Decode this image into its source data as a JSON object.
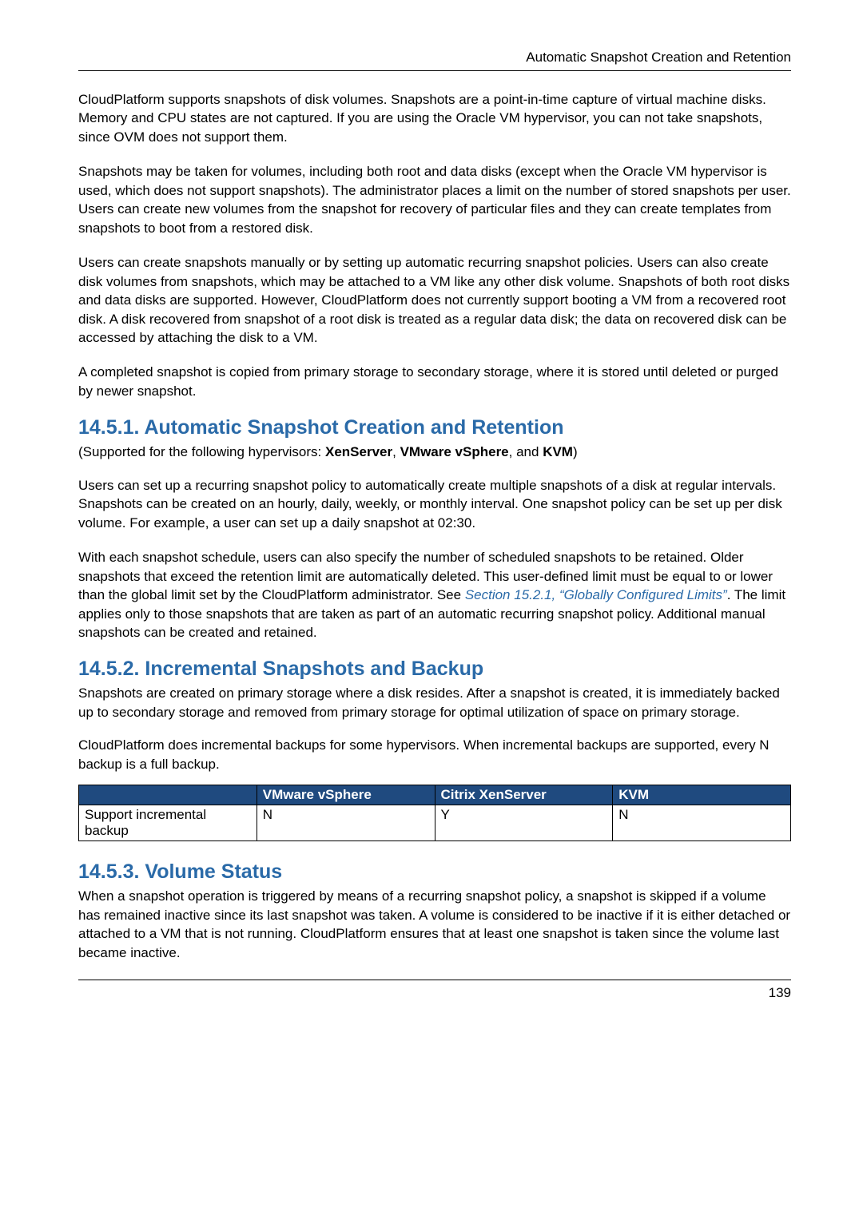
{
  "header": {
    "running": "Automatic Snapshot Creation and Retention"
  },
  "intro": {
    "p1": "CloudPlatform supports snapshots of disk volumes. Snapshots are a point-in-time capture of virtual machine disks. Memory and CPU states are not captured. If you are using the Oracle VM hypervisor, you can not take snapshots, since OVM does not support them.",
    "p2": "Snapshots may be taken for volumes, including both root and data disks (except when the Oracle VM hypervisor is used, which does not support snapshots). The administrator places a limit on the number of stored snapshots per user. Users can create new volumes from the snapshot for recovery of particular files and they can create templates from snapshots to boot from a restored disk.",
    "p3": "Users can create snapshots manually or by setting up automatic recurring snapshot policies. Users can also create disk volumes from snapshots, which may be attached to a VM like any other disk volume. Snapshots of both root disks and data disks are supported. However, CloudPlatform does not currently support booting a VM from a recovered root disk. A disk recovered from snapshot of a root disk is treated as a regular data disk; the data on recovered disk can be accessed by attaching the disk to a VM.",
    "p4": "A completed snapshot is copied from primary storage to secondary storage, where it is stored until deleted or purged by newer snapshot."
  },
  "sec1": {
    "heading": "14.5.1. Automatic Snapshot Creation and Retention",
    "sub_pre": "(Supported for the following hypervisors: ",
    "hv1": "XenServer",
    "hv2": "VMware vSphere",
    "hv3": "KVM",
    "sub_mid1": ", ",
    "sub_mid2": ", and ",
    "sub_post": ")",
    "p1": "Users can set up a recurring snapshot policy to automatically create multiple snapshots of a disk at regular intervals. Snapshots can be created on an hourly, daily, weekly, or monthly interval. One snapshot policy can be set up per disk volume. For example, a user can set up a daily snapshot at 02:30.",
    "p2a": "With each snapshot schedule, users can also specify the number of scheduled snapshots to be retained. Older snapshots that exceed the retention limit are automatically deleted. This user-defined limit must be equal to or lower than the global limit set by the CloudPlatform administrator. See ",
    "link": "Section 15.2.1, “Globally Configured Limits”",
    "p2b": ". The limit applies only to those snapshots that are taken as part of an automatic recurring snapshot policy. Additional manual snapshots can be created and retained."
  },
  "sec2": {
    "heading": "14.5.2. Incremental Snapshots and Backup",
    "p1": "Snapshots are created on primary storage where a disk resides. After a snapshot is created, it is immediately backed up to secondary storage and removed from primary storage for optimal utilization of space on primary storage.",
    "p2": "CloudPlatform does incremental backups for some hypervisors. When incremental backups are supported, every N backup is a full backup."
  },
  "table": {
    "h_blank": "",
    "h1": "VMware vSphere",
    "h2": "Citrix XenServer",
    "h3": "KVM",
    "rowlabel": "Support incremental backup",
    "v1": "N",
    "v2": "Y",
    "v3": "N"
  },
  "sec3": {
    "heading": "14.5.3. Volume Status",
    "p1": "When a snapshot operation is triggered by means of a recurring snapshot policy, a snapshot is skipped if a volume has remained inactive since its last snapshot was taken. A volume is considered to be inactive if it is either detached or attached to a VM that is not running. CloudPlatform ensures that at least one snapshot is taken since the volume last became inactive."
  },
  "footer": {
    "page": "139"
  }
}
